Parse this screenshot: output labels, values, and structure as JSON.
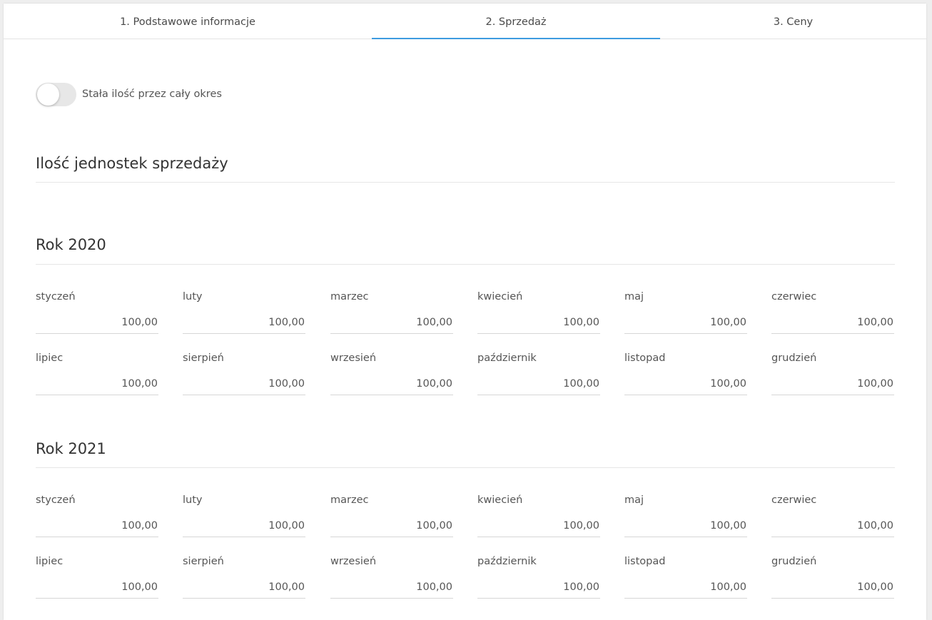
{
  "tabs": [
    "1. Podstawowe informacje",
    "2. Sprzedaż",
    "3. Ceny"
  ],
  "toggle": {
    "label": "Stała ilość przez cały okres",
    "on": false
  },
  "section_title": "Ilość jednostek sprzedaży",
  "years": [
    {
      "title": "Rok 2020",
      "months": [
        {
          "label": "styczeń",
          "value": "100,00"
        },
        {
          "label": "luty",
          "value": "100,00"
        },
        {
          "label": "marzec",
          "value": "100,00"
        },
        {
          "label": "kwiecień",
          "value": "100,00"
        },
        {
          "label": "maj",
          "value": "100,00"
        },
        {
          "label": "czerwiec",
          "value": "100,00"
        },
        {
          "label": "lipiec",
          "value": "100,00"
        },
        {
          "label": "sierpień",
          "value": "100,00"
        },
        {
          "label": "wrzesień",
          "value": "100,00"
        },
        {
          "label": "październik",
          "value": "100,00"
        },
        {
          "label": "listopad",
          "value": "100,00"
        },
        {
          "label": "grudzień",
          "value": "100,00"
        }
      ]
    },
    {
      "title": "Rok 2021",
      "months": [
        {
          "label": "styczeń",
          "value": "100,00"
        },
        {
          "label": "luty",
          "value": "100,00"
        },
        {
          "label": "marzec",
          "value": "100,00"
        },
        {
          "label": "kwiecień",
          "value": "100,00"
        },
        {
          "label": "maj",
          "value": "100,00"
        },
        {
          "label": "czerwiec",
          "value": "100,00"
        },
        {
          "label": "lipiec",
          "value": "100,00"
        },
        {
          "label": "sierpień",
          "value": "100,00"
        },
        {
          "label": "wrzesień",
          "value": "100,00"
        },
        {
          "label": "październik",
          "value": "100,00"
        },
        {
          "label": "listopad",
          "value": "100,00"
        },
        {
          "label": "grudzień",
          "value": "100,00"
        }
      ]
    }
  ],
  "colors": {
    "active_tab": "#3d9be0"
  }
}
